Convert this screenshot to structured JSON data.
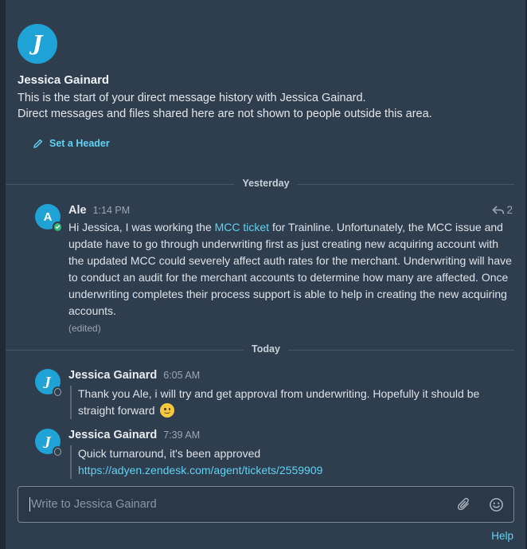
{
  "intro": {
    "avatar_initial": "J",
    "name": "Jessica Gainard",
    "line1": "This is the start of your direct message history with Jessica Gainard.",
    "line2": "Direct messages and files shared here are not shown to people outside this area.",
    "set_header_label": "Set a Header"
  },
  "dividers": {
    "yesterday": "Yesterday",
    "today": "Today"
  },
  "posts": [
    {
      "avatar_initial": "A",
      "author": "Ale",
      "time": "1:14 PM",
      "status": "online",
      "reply_count": "2",
      "text_before_link": "Hi Jessica,  I was working the ",
      "link_text": "MCC ticket",
      "text_after_link": " for Trainline.  Unfortunately, the MCC issue and update have to go through underwriting first as just creating new acquiring account with the updated MCC could severely affect auth rates for the merchant. Underwriting will have to conduct an audit for the merchant accounts to determine how many are affected. Once underwriting completes their process support is able to help in creating the new acquiring accounts.",
      "edited_label": "(edited)"
    },
    {
      "avatar_initial": "J",
      "author": "Jessica Gainard",
      "time": "6:05 AM",
      "status": "offline",
      "text": "Thank you Ale, i will try and get approval from underwriting. Hopefully it should be straight forward"
    },
    {
      "avatar_initial": "J",
      "author": "Jessica Gainard",
      "time": "7:39 AM",
      "status": "offline",
      "text": "Quick turnaround, it's been approved",
      "link_text": "https://adyen.zendesk.com/agent/tickets/2559909"
    }
  ],
  "composer": {
    "placeholder": "Write to Jessica Gainard",
    "value": ""
  },
  "footer": {
    "help_label": "Help"
  },
  "icons": [
    "pencil-icon",
    "reply-arrow-icon",
    "attachment-icon",
    "emoji-icon",
    "online-check-icon",
    "slightly-smiling-emoji"
  ],
  "colors": {
    "background": "#2f3e4e",
    "accent_link": "#5fd3f3",
    "avatar": "#1fa2d6",
    "online": "#3bb77e"
  }
}
